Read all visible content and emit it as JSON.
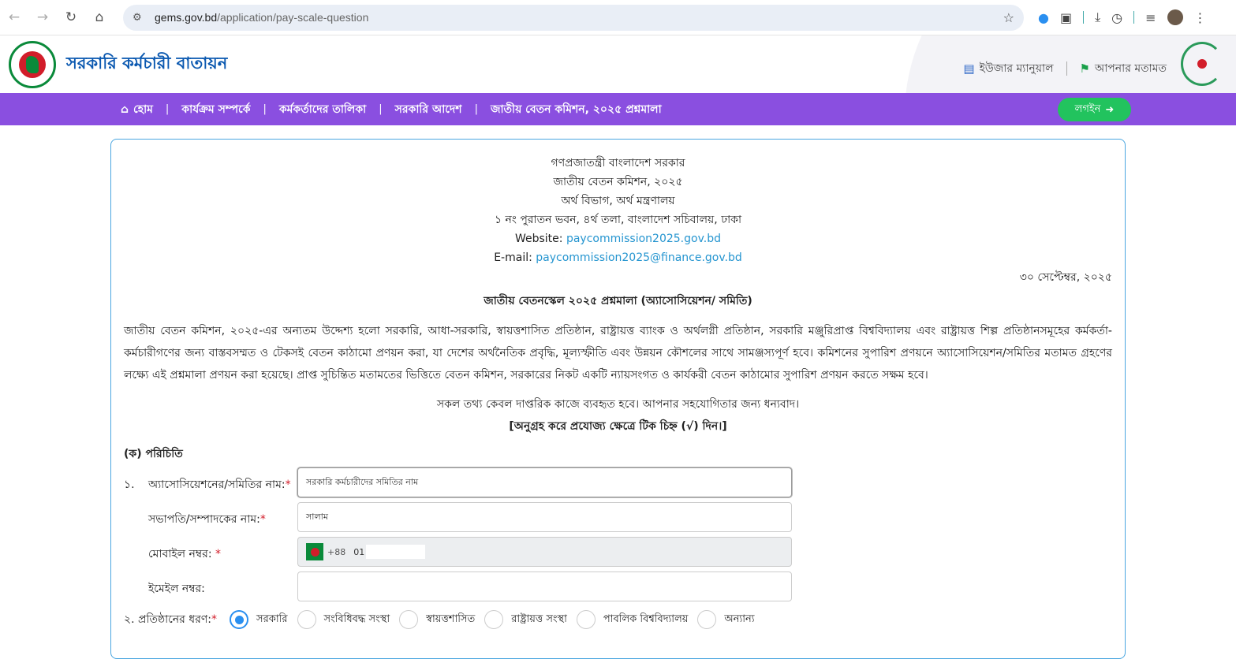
{
  "browser": {
    "url_domain": "gems.gov.bd",
    "url_path": "/application/pay-scale-question"
  },
  "header": {
    "brand": "সরকারি কর্মচারী বাতায়ন",
    "user_manual": "ইউজার ম্যানুয়াল",
    "your_opinion": "আপনার মতামত"
  },
  "nav": {
    "items": [
      "হোম",
      "কার্যক্রম সম্পর্কে",
      "কর্মকর্তাদের তালিকা",
      "সরকারি আদেশ",
      "জাতীয় বেতন কমিশন, ২০২৫ প্রশ্নমালা"
    ],
    "login": "লগইন"
  },
  "letterhead": {
    "line1": "গণপ্রজাতন্ত্রী বাংলাদেশ সরকার",
    "line2": "জাতীয় বেতন কমিশন, ২০২৫",
    "line3": "অর্থ বিভাগ, অর্থ মন্ত্রণালয়",
    "line4": "১ নং পুরাতন ভবন, ৪র্থ তলা, বাংলাদেশ সচিবালয়, ঢাকা",
    "website_label": "Website:",
    "website": "paycommission2025.gov.bd",
    "email_label": "E-mail:",
    "email": "paycommission2025@finance.gov.bd"
  },
  "date": "৩০ সেপ্টেম্বর, ২০২৫",
  "title": "জাতীয় বেতনস্কেল ২০২৫ প্রশ্নমালা (অ্যাসোসিয়েশন/ সমিতি)",
  "paragraph": "জাতীয় বেতন কমিশন, ২০২৫-এর অন্যতম উদ্দেশ্য হলো সরকারি, আধা-সরকারি, স্বায়ত্তশাসিত প্রতিষ্ঠান, রাষ্ট্রায়ত্ত ব্যাংক ও অর্থলগ্নী প্রতিষ্ঠান, সরকারি মঞ্জুরিপ্রাপ্ত বিশ্ববিদ্যালয় এবং রাষ্ট্রায়ত্ত শিল্প প্রতিষ্ঠানসমূহের কর্মকর্তা-কর্মচারীগণের জন্য বাস্তবসম্মত ও টেকসই বেতন কাঠামো প্রণয়ন করা, যা দেশের অর্থনৈতিক প্রবৃদ্ধি, মূল্যস্ফীতি এবং উন্নয়ন কৌশলের সাথে সামঞ্জস্যপূর্ণ হবে। কমিশনের সুপারিশ প্রণয়নে অ্যাসোসিয়েশন/সমিতির মতামত গ্রহণের লক্ষ্যে এই প্রশ্নমালা প্রণয়ন করা হয়েছে। প্রাপ্ত সুচিন্তিত মতামতের ভিত্তিতে বেতন কমিশন, সরকারের নিকট একটি ন্যায়সংগত ও কার্যকরী বেতন কাঠামোর সুপারিশ প্রণয়ন করতে সক্ষম হবে।",
  "note": "সকল তথ্য কেবল দাপ্তরিক কাজে ব্যবহৃত হবে। আপনার সহযোগিতার জন্য ধন্যবাদ।",
  "instruction": "[অনুগ্রহ করে প্রযোজ্য ক্ষেত্রে টিক চিহ্ন (√) দিন।]",
  "section_a": "(ক) পরিচিতি",
  "form": {
    "q1_num": "১.",
    "assoc_name_label": "অ্যাসোসিয়েশনের/সমিতির নাম:",
    "assoc_name_value": "সরকারি কর্মচারীদের সমিতির নাম",
    "president_label": "সভাপতি/সম্পাদকের নাম:",
    "president_value": "সালাম",
    "mobile_label": "মোবাইল নম্বর:",
    "mobile_cc": "+88",
    "mobile_value": "01",
    "email_label": "ইমেইল নম্বর:",
    "email_value": "",
    "required_mark": "*",
    "q2_label": "২. প্রতিষ্ঠানের ধরণ:",
    "org_types": [
      "সরকারি",
      "সংবিধিবদ্ধ সংস্থা",
      "স্বায়ত্তশাসিত",
      "রাষ্ট্রায়ত্ত সংস্থা",
      "পাবলিক বিশ্ববিদ্যালয়",
      "অন্যান্য"
    ],
    "org_type_selected": "সরকারি"
  },
  "colors": {
    "nav_purple": "#8a4fe0",
    "login_green": "#22c35e",
    "brand_blue": "#0a58b0",
    "link_blue": "#2595d0",
    "radio_blue": "#2a8ff0"
  }
}
